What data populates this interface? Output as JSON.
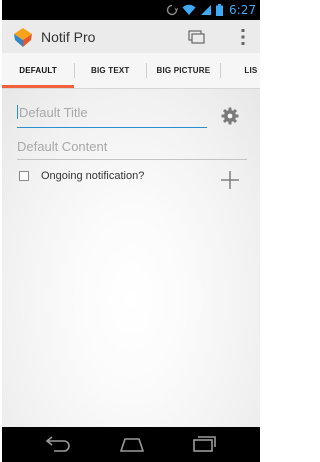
{
  "status_bar": {
    "time": "6:27",
    "icons": [
      "sync-icon",
      "wifi-icon",
      "signal-icon",
      "battery-icon"
    ]
  },
  "action_bar": {
    "app_title": "Notif Pro",
    "logo_icon": "notif-pro-logo",
    "actions": [
      "copy-icon",
      "overflow-menu-icon"
    ]
  },
  "tabs": [
    {
      "label": "DEFAULT",
      "active": true
    },
    {
      "label": "BIG TEXT",
      "active": false
    },
    {
      "label": "BIG PICTURE",
      "active": false
    },
    {
      "label": "LIS",
      "active": false
    }
  ],
  "form": {
    "title_placeholder": "Default Title",
    "content_placeholder": "Default Content",
    "ongoing_label": "Ongoing notification?",
    "ongoing_checked": false
  },
  "colors": {
    "accent_tab": "#f1623a",
    "focus_underline": "#2a8fd1",
    "status_icons": "#3fa9f5"
  },
  "nav": [
    "back-icon",
    "home-icon",
    "recent-apps-icon"
  ]
}
